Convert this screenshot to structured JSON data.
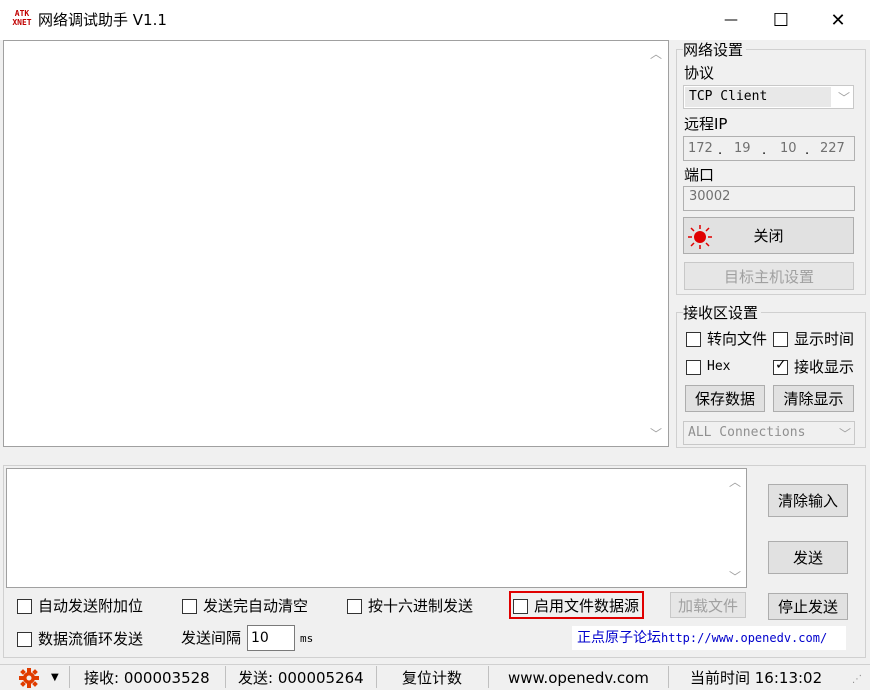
{
  "window": {
    "title": "网络调试助手 V1.1",
    "logo_line1": "ATK",
    "logo_line2": "XNET",
    "minimize": "—",
    "maximize": "☐",
    "close": "✕"
  },
  "network": {
    "group_title": "网络设置",
    "protocol_label": "协议",
    "protocol_value": "TCP Client",
    "remote_ip_label": "远程IP",
    "ip_parts": [
      "172",
      "19",
      "10",
      "227"
    ],
    "port_label": "端口",
    "port_value": "30002",
    "connect_button": "关闭",
    "target_button": "目标主机设置"
  },
  "receive": {
    "group_title": "接收区设置",
    "redirect_file": "转向文件",
    "show_time": "显示时间",
    "hex": "Hex",
    "show_receive": "接收显示",
    "save_data": "保存数据",
    "clear_display": "清除显示",
    "connections_value": "ALL Connections"
  },
  "send": {
    "clear_input": "清除输入",
    "send_button": "发送",
    "stop_send": "停止发送",
    "auto_append": "自动发送附加位",
    "auto_clear": "发送完自动清空",
    "hex_send": "按十六进制发送",
    "enable_file": "启用文件数据源",
    "load_file": "加载文件",
    "loop_send": "数据流循环发送",
    "interval_label": "发送间隔",
    "interval_value": "10",
    "interval_unit": "ms",
    "forum_text": "正点原子论坛",
    "forum_url": "http://www.openedv.com/"
  },
  "status": {
    "received": "接收: 000003528",
    "sent": "发送: 000005264",
    "reset_count": "复位计数",
    "website": "www.openedv.com",
    "current_time": "当前时间 16:13:02"
  },
  "colors": {
    "highlight_border": "#e00000",
    "link": "#0000cc",
    "gear": "#e03c00"
  }
}
